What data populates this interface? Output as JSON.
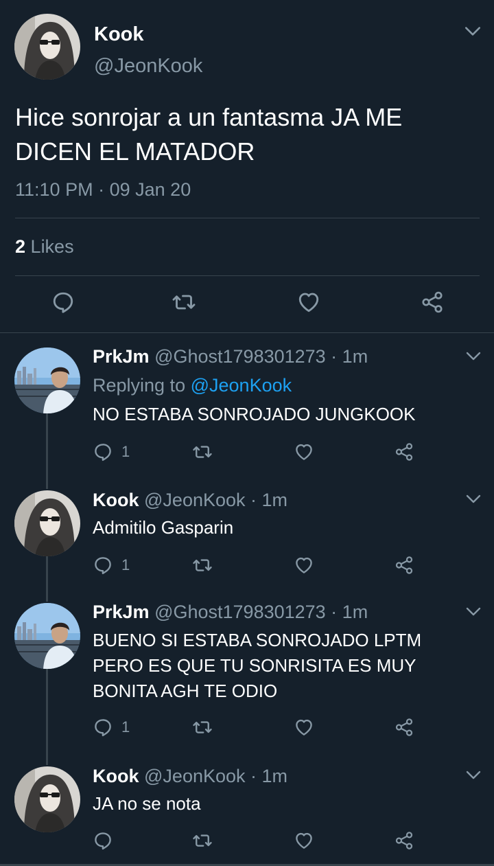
{
  "main_tweet": {
    "name": "Kook",
    "handle": "@JeonKook",
    "text_line1": "Hice sonrojar a un fantasma JA ME",
    "text_line2": "DICEN EL MATADOR",
    "time": "11:10 PM",
    "dot": "·",
    "date": "09 Jan 20",
    "likes_count": "2",
    "likes_label": "Likes"
  },
  "replies": [
    {
      "name": "PrkJm",
      "meta": "@Ghost1798301273 · 1m",
      "replying_prefix": "Replying to",
      "replying_handle": "@JeonKook",
      "lines": [
        "NO ESTABA SONROJADO JUNGKOOK"
      ],
      "reply_count": "1"
    },
    {
      "name": "Kook",
      "meta": "@JeonKook · 1m",
      "lines": [
        "Admitilo Gasparin"
      ],
      "reply_count": "1"
    },
    {
      "name": "PrkJm",
      "meta": "@Ghost1798301273 · 1m",
      "lines": [
        "BUENO SI ESTABA SONROJADO LPTM",
        "PERO ES QUE TU SONRISITA ES MUY",
        "BONITA AGH TE ODIO"
      ],
      "reply_count": "1"
    },
    {
      "name": "Kook",
      "meta": "@JeonKook · 1m",
      "lines": [
        "JA no se nota"
      ],
      "reply_count": ""
    }
  ],
  "icons": [
    "reply-icon",
    "retweet-icon",
    "like-icon",
    "share-icon",
    "chevron-down-icon"
  ],
  "colors": {
    "background": "#15202b",
    "secondary_text": "#8899a6",
    "link": "#1da1f2",
    "divider": "#38444d"
  }
}
